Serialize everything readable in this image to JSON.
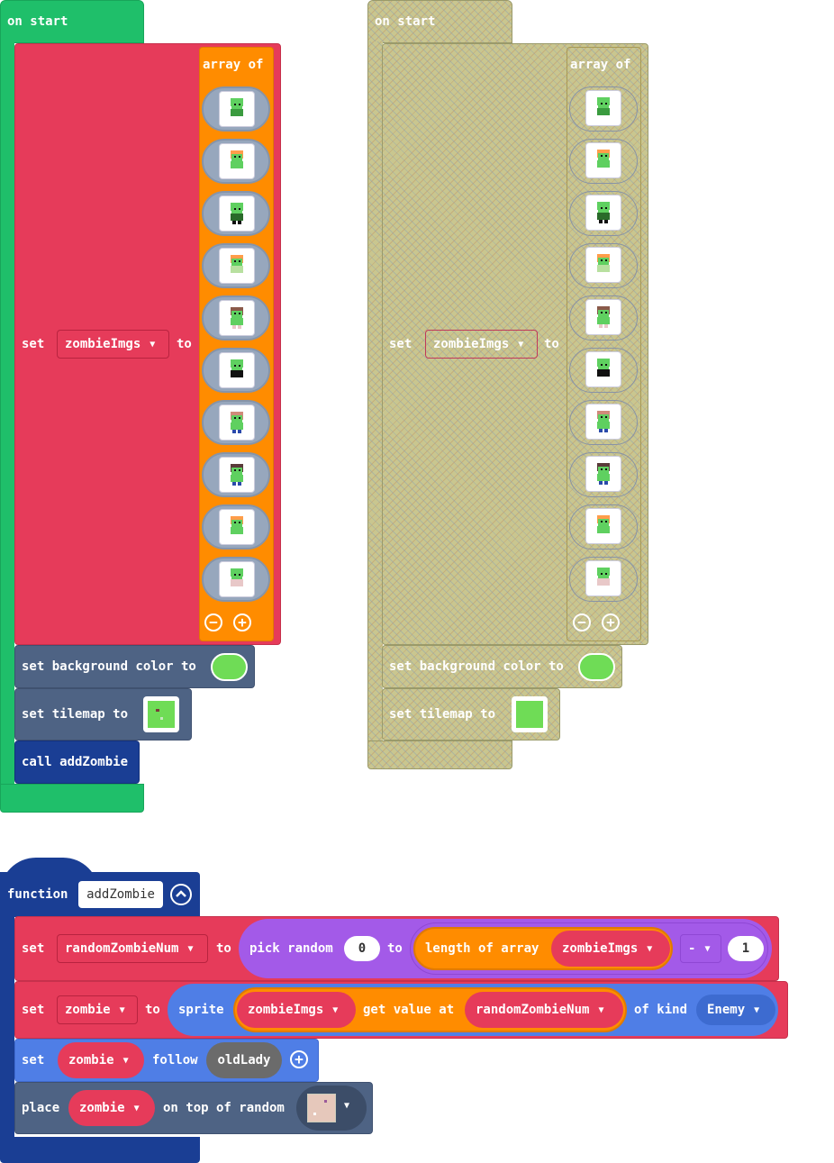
{
  "colors": {
    "event_green": "#1fbf6a",
    "variables_red": "#e63b5a",
    "array_orange": "#ff8c00",
    "scene_slate": "#4e6384",
    "function_blue": "#1a3e94",
    "math_purple": "#a35ae8",
    "sprites_blue": "#4f7ee6",
    "bg_swatch": "#6fdc56"
  },
  "on_start": {
    "label": "on start",
    "set_label": "set",
    "variable": "zombieImgs",
    "to_label": "to",
    "array_label": "array of",
    "images": [
      "zombie-1",
      "zombie-2",
      "zombie-3",
      "zombie-4",
      "zombie-5",
      "zombie-6",
      "zombie-7",
      "zombie-8",
      "zombie-9",
      "zombie-10"
    ],
    "bg_block": "set background color to",
    "tilemap_block": "set tilemap to",
    "call_block": "call addZombie"
  },
  "function_block": {
    "keyword": "function",
    "name": "addZombie",
    "row1": {
      "set": "set",
      "var": "randomZombieNum",
      "to": "to",
      "pick": "pick random",
      "from": "0",
      "to2": "to",
      "length": "length of array",
      "array": "zombieImgs",
      "op": "-",
      "num": "1"
    },
    "row2": {
      "set": "set",
      "var": "zombie",
      "to": "to",
      "sprite": "sprite",
      "array": "zombieImgs",
      "get": "get value at",
      "index": "randomZombieNum",
      "kind_label": "of kind",
      "kind": "Enemy"
    },
    "row3": {
      "set": "set",
      "var": "zombie",
      "follow": "follow",
      "target": "oldLady"
    },
    "row4": {
      "place": "place",
      "var": "zombie",
      "on_top": "on top of random"
    }
  }
}
